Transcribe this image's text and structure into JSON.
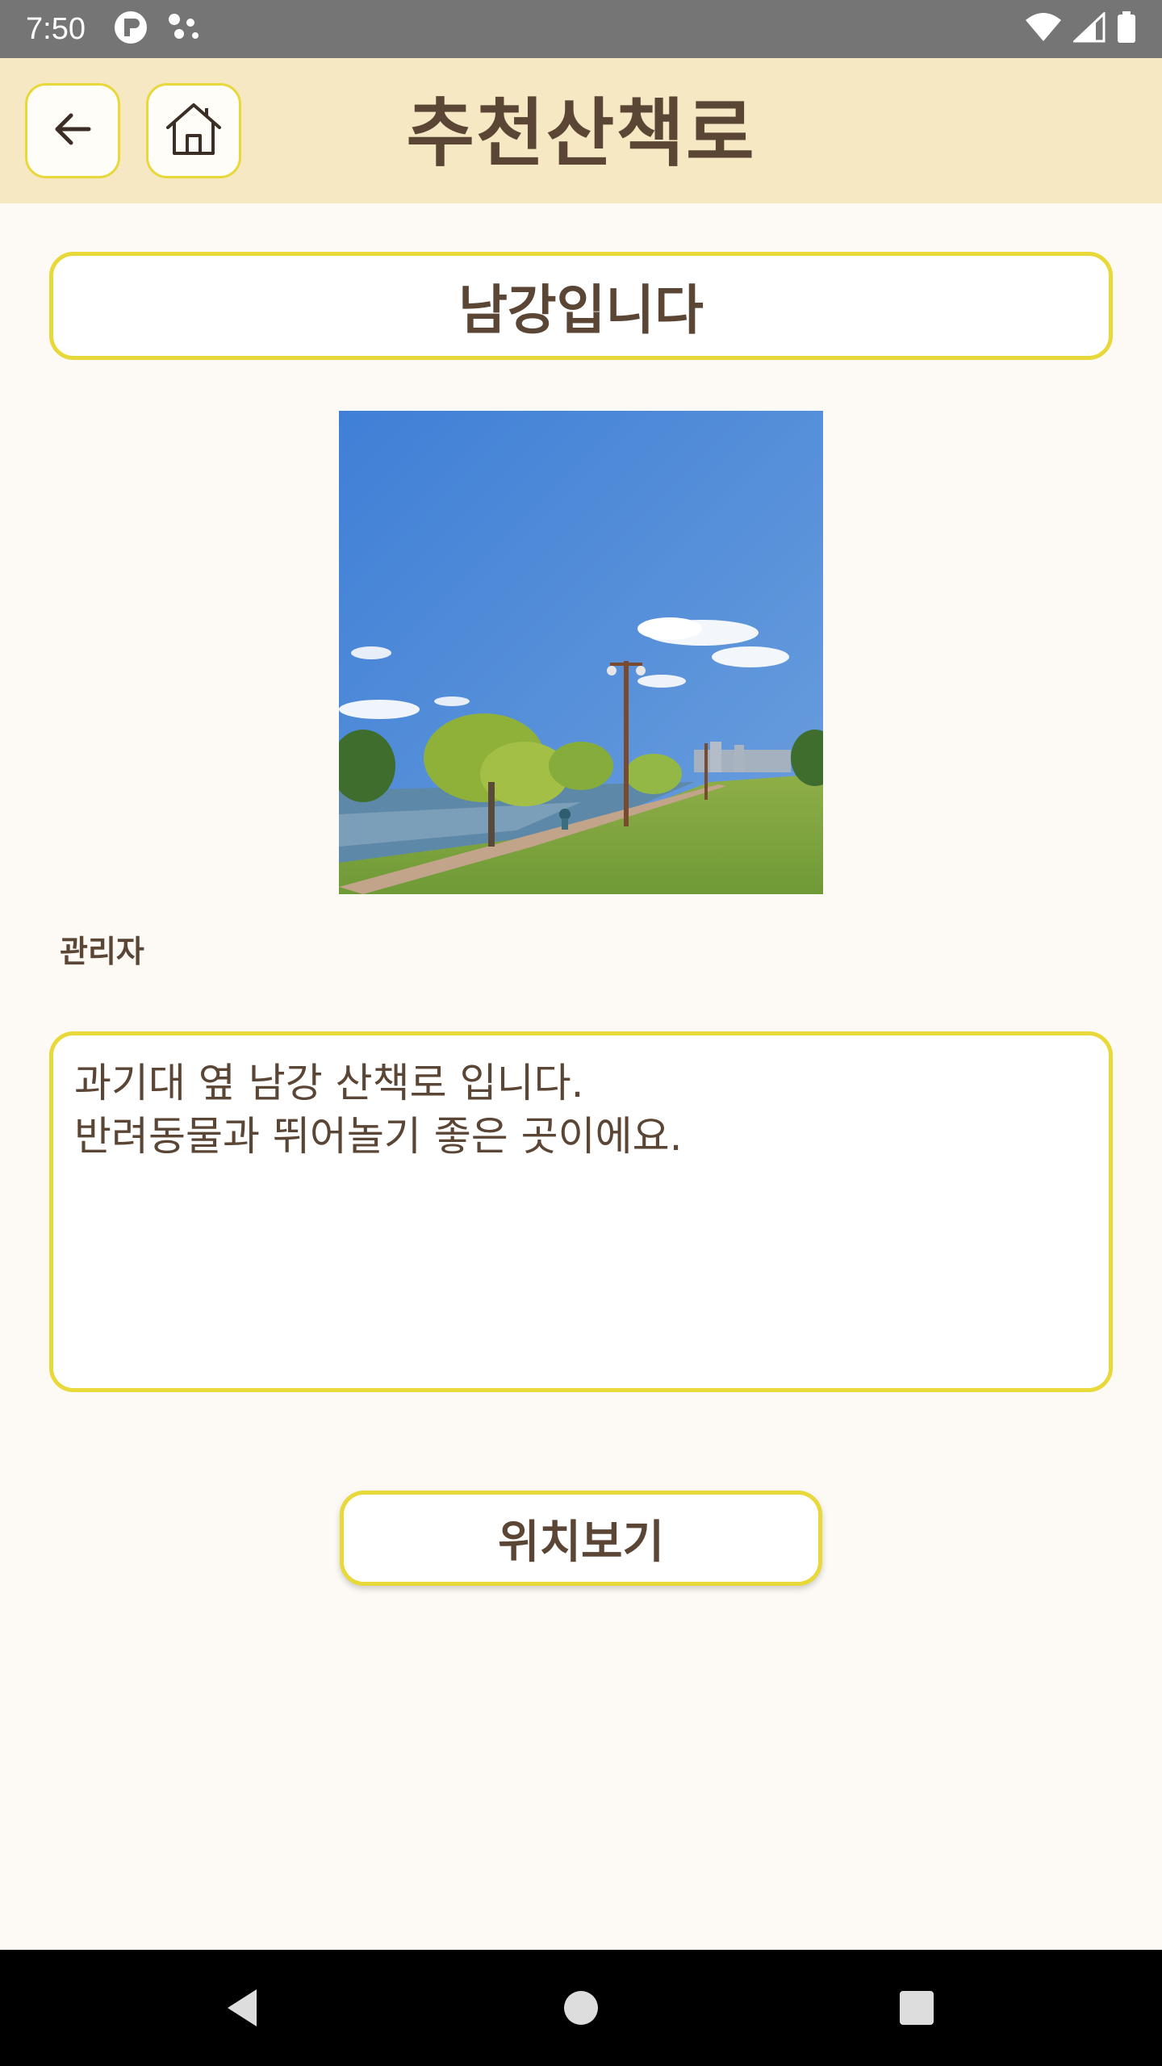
{
  "status_bar": {
    "time": "7:50",
    "left_icons": [
      "app-notification-icon",
      "assistant-dots-icon"
    ],
    "right_icons": [
      "wifi-icon",
      "cellular-signal-icon",
      "battery-icon"
    ]
  },
  "app_bar": {
    "title": "추천산책로",
    "back_icon": "arrow-left-icon",
    "home_icon": "home-icon"
  },
  "place": {
    "title": "남강입니다",
    "photo_description": "riverside walking path with trees and street lamps under blue sky",
    "author": "관리자",
    "description": "과기대 옆 남강 산책로 입니다.\n반려동물과 뛰어놀기 좋은 곳이에요."
  },
  "actions": {
    "location_label": "위치보기"
  },
  "nav_bar": {
    "icons": [
      "back-triangle-icon",
      "home-circle-icon",
      "recents-square-icon"
    ]
  },
  "colors": {
    "app_bar_bg": "#f5e8c2",
    "accent_border": "#e8d83a",
    "text_brown": "#5b4636",
    "page_bg": "#fdfaf5"
  }
}
